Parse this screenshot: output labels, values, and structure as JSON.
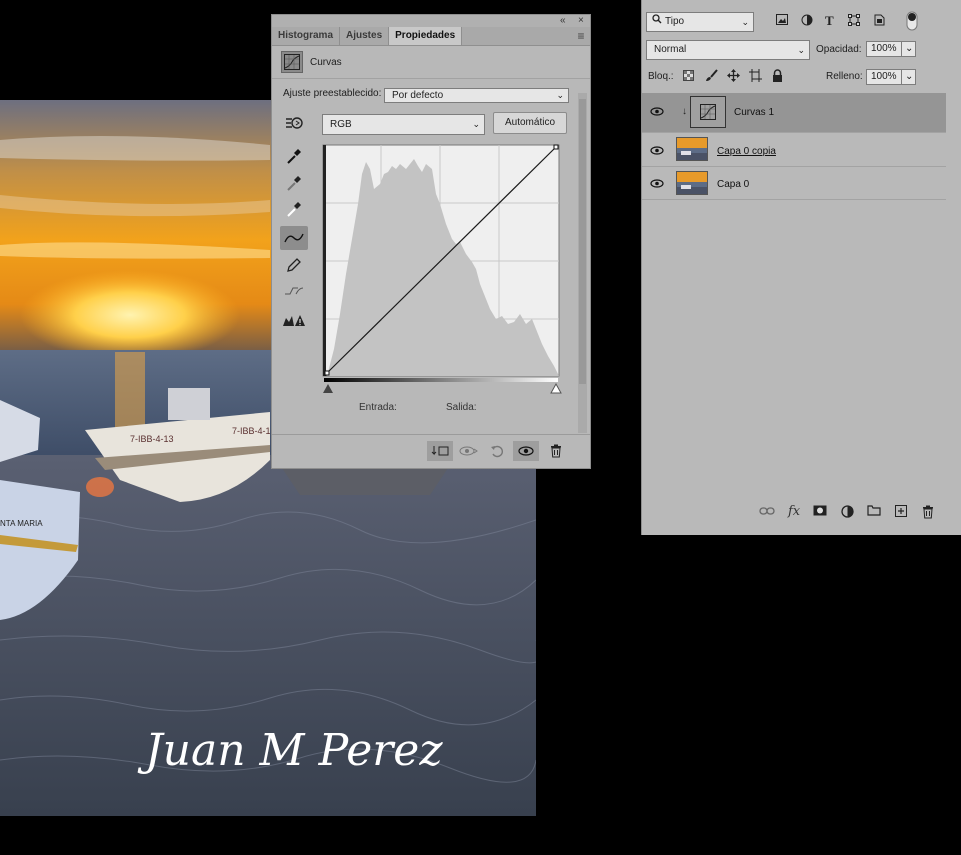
{
  "properties_panel": {
    "tabs": [
      "Histograma",
      "Ajustes",
      "Propiedades"
    ],
    "active_tab": "Propiedades",
    "collapse_glyph": "«",
    "close_glyph": "×",
    "menu_glyph": "≡",
    "header_title": "Curvas",
    "preset_label": "Ajuste preestablecido:",
    "preset_value": "Por defecto",
    "channel_value": "RGB",
    "auto_button": "Automático",
    "input_label": "Entrada:",
    "output_label": "Salida:",
    "tools": [
      "on-image-adjust-icon",
      "eyedropper-black-icon",
      "eyedropper-gray-icon",
      "eyedropper-white-icon",
      "curve-points-icon",
      "pencil-icon",
      "smooth-icon",
      "clipping-warning-icon"
    ],
    "active_tool": "curve-points-icon",
    "footer_buttons": [
      "clip-to-layer-icon",
      "view-previous-icon",
      "reset-icon",
      "visibility-icon",
      "delete-icon"
    ]
  },
  "layers_panel": {
    "filter_value": "Tipo",
    "blend_mode": "Normal",
    "opacity_label": "Opacidad:",
    "opacity_value": "100%",
    "lock_label": "Bloq.:",
    "fill_label": "Relleno:",
    "fill_value": "100%",
    "layers": [
      {
        "name": "Curvas 1",
        "selected": true,
        "type": "adjustment"
      },
      {
        "name": "Capa 0 copia",
        "selected": false,
        "type": "image"
      },
      {
        "name": "Capa 0",
        "selected": false,
        "type": "image"
      }
    ]
  },
  "canvas": {
    "signature": "Juan M Perez",
    "boat_registrations": [
      "7-IBB-4-13",
      "7-IBB-4-1"
    ],
    "boat_name": "NTA MARIA"
  }
}
